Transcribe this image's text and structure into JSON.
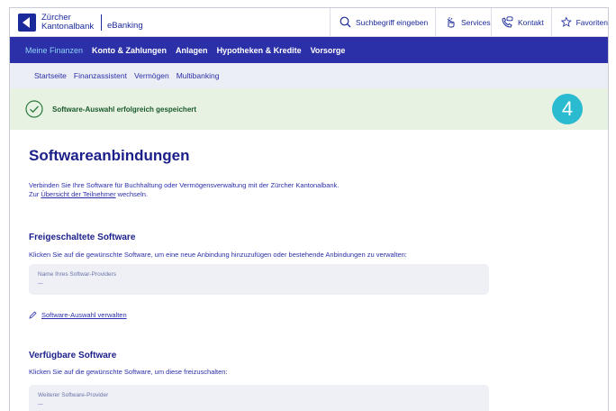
{
  "header": {
    "bank_line1": "Zürcher",
    "bank_line2": "Kantonalbank",
    "app_name": "eBanking",
    "search_placeholder": "Suchbegriff eingeben",
    "services": "Services",
    "contact": "Kontakt",
    "favorites": "Favoriten"
  },
  "main_nav": [
    "Meine Finanzen",
    "Konto & Zahlungen",
    "Anlagen",
    "Hypotheken & Kredite",
    "Vorsorge"
  ],
  "sub_nav": [
    "Startseite",
    "Finanzassistent",
    "Vermögen",
    "Multibanking"
  ],
  "banner": {
    "message": "Software-Auswahl erfolgreich gespeichert",
    "step_number": "4"
  },
  "page": {
    "title": "Softwareanbindungen",
    "intro_line1": "Verbinden Sie Ihre Software für Buchhaltung oder Vermögensverwaltung mit der Zürcher Kantonalbank.",
    "intro_prefix": "Zur",
    "intro_link": "Übersicht der Teilnehmer",
    "intro_suffix": "wechseln."
  },
  "activated": {
    "heading": "Freigeschaltete Software",
    "description": "Klicken Sie auf die gewünschte Software, um eine neue Anbindung hinzuzufügen oder bestehende Anbindungen zu verwalten:",
    "card_label": "Name Ihres Softwar-Providers",
    "card_value": "...",
    "manage_link": "Software-Auswahl verwalten"
  },
  "available": {
    "heading": "Verfügbare Software",
    "description": "Klicken Sie auf die gewünschte Software, um diese freizuschalten:",
    "card_label": "Weiterer Software-Provider",
    "card_value": "..."
  },
  "colors": {
    "brand_blue": "#2b2fa8",
    "success_bg": "#e7f2e3",
    "step_badge": "#2bbbd0"
  }
}
